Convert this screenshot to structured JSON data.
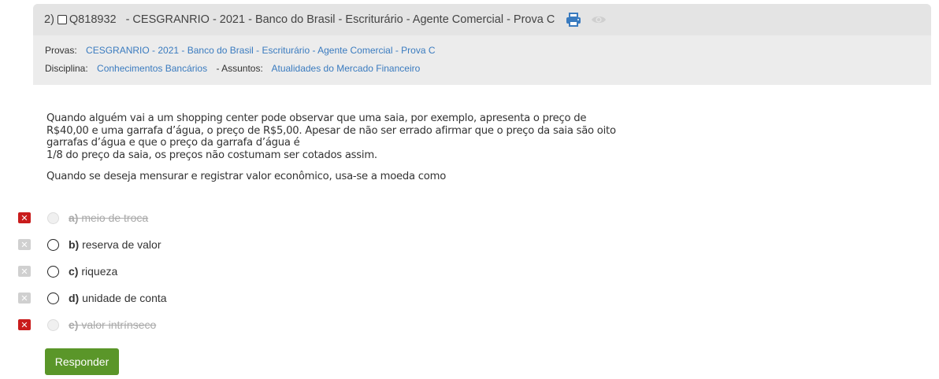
{
  "question": {
    "number": "2)",
    "id": "Q818932",
    "title": "- CESGRANRIO - 2021 - Banco do Brasil - Escriturário - Agente Comercial - Prova C",
    "provas_label": "Provas:",
    "provas_value": "CESGRANRIO - 2021 - Banco do Brasil - Escriturário - Agente Comercial - Prova C",
    "disciplina_label": "Disciplina:",
    "disciplina_value": "Conhecimentos Bancários",
    "assuntos_label": "- Assuntos:",
    "assuntos_value": "Atualidades do Mercado Financeiro",
    "icons": [
      "print-icon",
      "eye-icon"
    ]
  },
  "enunciado": {
    "lines": [
      "Quando alguém vai a um shopping center pode observar que uma saia, por exemplo, apresenta o preço de",
      "R$40,00 e uma garrafa d’água, o preço de R$5,00. Apesar de não ser errado afirmar que o preço da saia são oito",
      "garrafas d’água e que o preço da garrafa d’água é",
      "1/8 do preço da saia, os preços não costumam ser cotados assim."
    ],
    "comando": "Quando se deseja mensurar e registrar valor econômico, usa-se a moeda como"
  },
  "alternatives": [
    {
      "letter": "a)",
      "text": "meio de troca",
      "eliminated": true
    },
    {
      "letter": "b)",
      "text": "reserva de valor",
      "eliminated": false
    },
    {
      "letter": "c)",
      "text": "riqueza",
      "eliminated": false
    },
    {
      "letter": "d)",
      "text": "unidade de conta",
      "eliminated": false
    },
    {
      "letter": "e)",
      "text": "valor intrínseco",
      "eliminated": true
    }
  ],
  "submit_label": "Responder",
  "colors": {
    "link": "#3a7bbf",
    "eliminated_x": "#c91c1c",
    "submit": "#5a9629",
    "header_bg": "#ececec"
  }
}
